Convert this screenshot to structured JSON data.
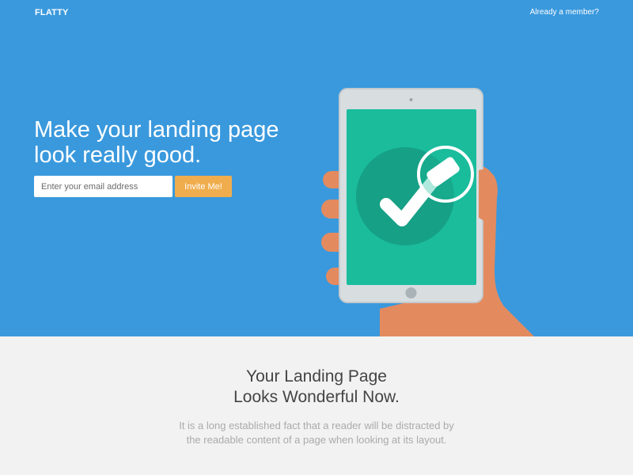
{
  "header": {
    "logo": "FLATTY",
    "member_link": "Already a member?"
  },
  "hero": {
    "headline": "Make your landing page look really good.",
    "email_placeholder": "Enter your email address",
    "invite_button": "Invite Me!"
  },
  "section": {
    "title_line1": "Your Landing Page",
    "title_line2": "Looks Wonderful Now.",
    "description": "It is a long established fact that a reader will be distracted by the readable content of a page when looking at its layout."
  },
  "colors": {
    "hero_bg": "#3a99dd",
    "button": "#f0ad4e",
    "screen": "#1abc9c",
    "circle": "#16a085"
  }
}
